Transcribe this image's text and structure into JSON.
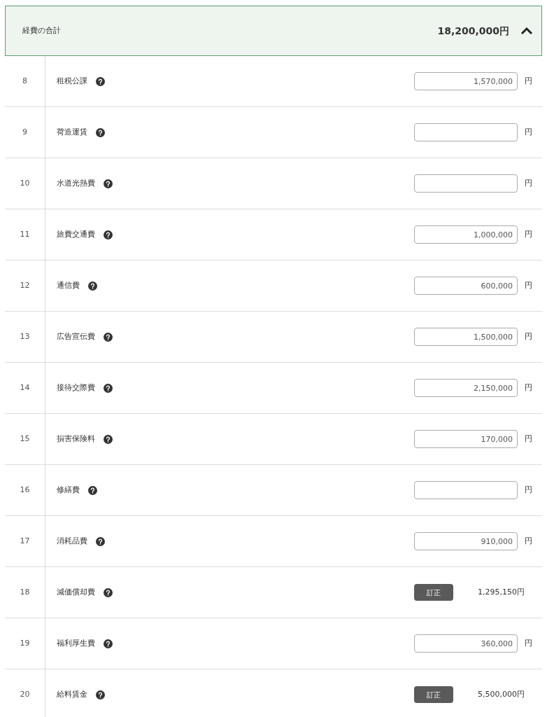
{
  "summary": {
    "label": "経費の合計",
    "total": "18,200,000円",
    "expanded": true
  },
  "rows": [
    {
      "no": "8",
      "name": "租税公課",
      "kind": "input",
      "value": "1,570,000",
      "unit": "円"
    },
    {
      "no": "9",
      "name": "荷造運賃",
      "kind": "input",
      "unit": "円"
    },
    {
      "no": "10",
      "name": "水道光熱費",
      "kind": "input",
      "unit": "円"
    },
    {
      "no": "11",
      "name": "旅費交通費",
      "kind": "input",
      "value": "1,000,000",
      "unit": "円"
    },
    {
      "no": "12",
      "name": "通信費",
      "kind": "input",
      "value": "600,000",
      "unit": "円"
    },
    {
      "no": "13",
      "name": "広告宣伝費",
      "kind": "input",
      "value": "1,500,000",
      "unit": "円"
    },
    {
      "no": "14",
      "name": "接待交際費",
      "kind": "input",
      "value": "2,150,000",
      "unit": "円"
    },
    {
      "no": "15",
      "name": "損害保険料",
      "kind": "input",
      "value": "170,000",
      "unit": "円"
    },
    {
      "no": "16",
      "name": "修繕費",
      "kind": "input",
      "unit": "円"
    },
    {
      "no": "17",
      "name": "消耗品費",
      "kind": "input",
      "value": "910,000",
      "unit": "円"
    },
    {
      "no": "18",
      "name": "減価償却費",
      "kind": "fixed",
      "button": "訂正",
      "amount": "1,295,150円"
    },
    {
      "no": "19",
      "name": "福利厚生費",
      "kind": "input",
      "value": "360,000",
      "unit": "円"
    },
    {
      "no": "20",
      "name": "給料賃金",
      "kind": "fixed",
      "button": "訂正",
      "amount": "5,500,000円"
    }
  ]
}
